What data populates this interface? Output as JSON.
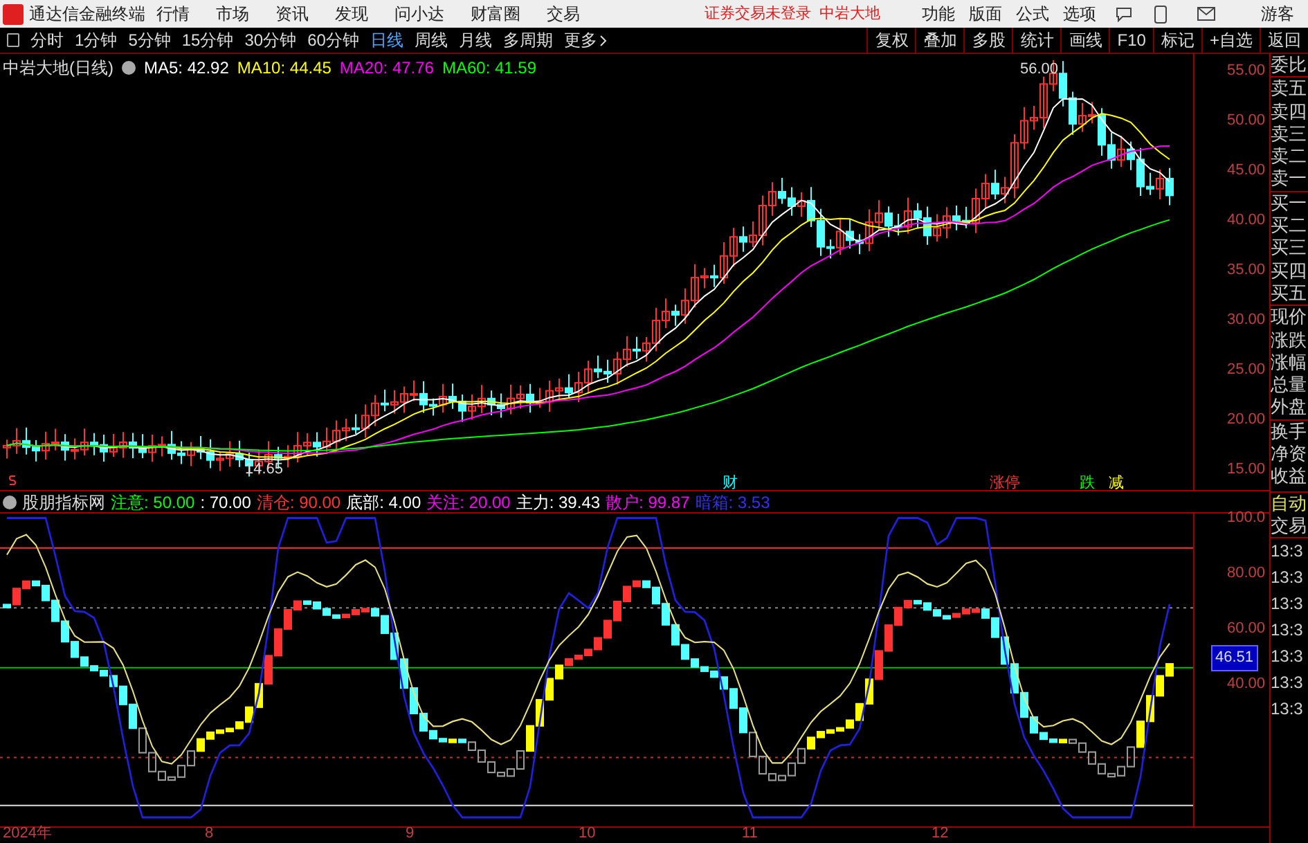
{
  "top_bar": {
    "app_title": "通达信金融终端",
    "menus": [
      "行情",
      "市场",
      "资讯",
      "发现",
      "问小达",
      "财富圈",
      "交易"
    ],
    "status_text": "证券交易未登录",
    "stock_name": "中岩大地",
    "right_menus": [
      "功能",
      "版面",
      "公式",
      "选项"
    ],
    "user": "游客"
  },
  "toolbar": {
    "periods": [
      {
        "label": "分时",
        "selected": false
      },
      {
        "label": "1分钟",
        "selected": false
      },
      {
        "label": "5分钟",
        "selected": false
      },
      {
        "label": "15分钟",
        "selected": false
      },
      {
        "label": "30分钟",
        "selected": false
      },
      {
        "label": "60分钟",
        "selected": false
      },
      {
        "label": "日线",
        "selected": true
      },
      {
        "label": "周线",
        "selected": false
      },
      {
        "label": "月线",
        "selected": false
      },
      {
        "label": "多周期",
        "selected": false
      }
    ],
    "more": "更多",
    "buttons": [
      "复权",
      "叠加",
      "多股",
      "统计",
      "画线",
      "F10",
      "标记",
      "+自选",
      "返回"
    ]
  },
  "chart": {
    "title": "中岩大地(日线)",
    "ma": [
      {
        "label": "MA5: 42.92",
        "color": "#ffffff"
      },
      {
        "label": "MA10: 44.45",
        "color": "#ffff00"
      },
      {
        "label": "MA20: 47.76",
        "color": "#ff00ff"
      },
      {
        "label": "MA60: 41.59",
        "color": "#00ff00"
      }
    ],
    "y_labels": [
      "55.00",
      "50.00",
      "45.00",
      "40.00",
      "35.00",
      "30.00",
      "25.00",
      "20.00",
      "15.00"
    ],
    "high_label": "56.00",
    "low_label": "14.65",
    "events": [
      {
        "label": "财",
        "color": "#00ffff"
      },
      {
        "label": "涨停",
        "color": "#ff3333"
      },
      {
        "label": "跌",
        "color": "#00ff00"
      },
      {
        "label": "减",
        "color": "#ffff00"
      }
    ]
  },
  "indicator": {
    "name": "股朋指标网",
    "values": [
      {
        "label": "注意: 50.00",
        "color": "#00ff00"
      },
      {
        "label": ": 70.00",
        "color": "#ffffff"
      },
      {
        "label": "清仓: 90.00",
        "color": "#ff3333"
      },
      {
        "label": "底部: 4.00",
        "color": "#ffffff"
      },
      {
        "label": "关注: 20.00",
        "color": "#ff00ff"
      },
      {
        "label": "主力: 39.43",
        "color": "#ffffff"
      },
      {
        "label": "散户: 99.87",
        "color": "#ff00ff"
      },
      {
        "label": "暗箱: 3.53",
        "color": "#3030ff"
      }
    ],
    "y_labels": [
      "100.0",
      "80.00",
      "60.00",
      "40.00"
    ],
    "current_value": "46.51"
  },
  "x_axis": [
    "2024年",
    "8",
    "9",
    "10",
    "11",
    "12"
  ],
  "side_panel": {
    "quote_items": [
      "委比",
      "卖五",
      "卖四",
      "卖三",
      "卖二",
      "卖一",
      "买一",
      "买二",
      "买三",
      "买四",
      "买五",
      "现价",
      "涨跌",
      "涨幅",
      "总量",
      "外盘",
      "换手",
      "净资",
      "收益"
    ],
    "auto": "自动",
    "trade": "交易",
    "times": [
      "13:3",
      "13:3",
      "13:3",
      "13:3",
      "13:3",
      "13:3",
      "13:3"
    ]
  }
}
